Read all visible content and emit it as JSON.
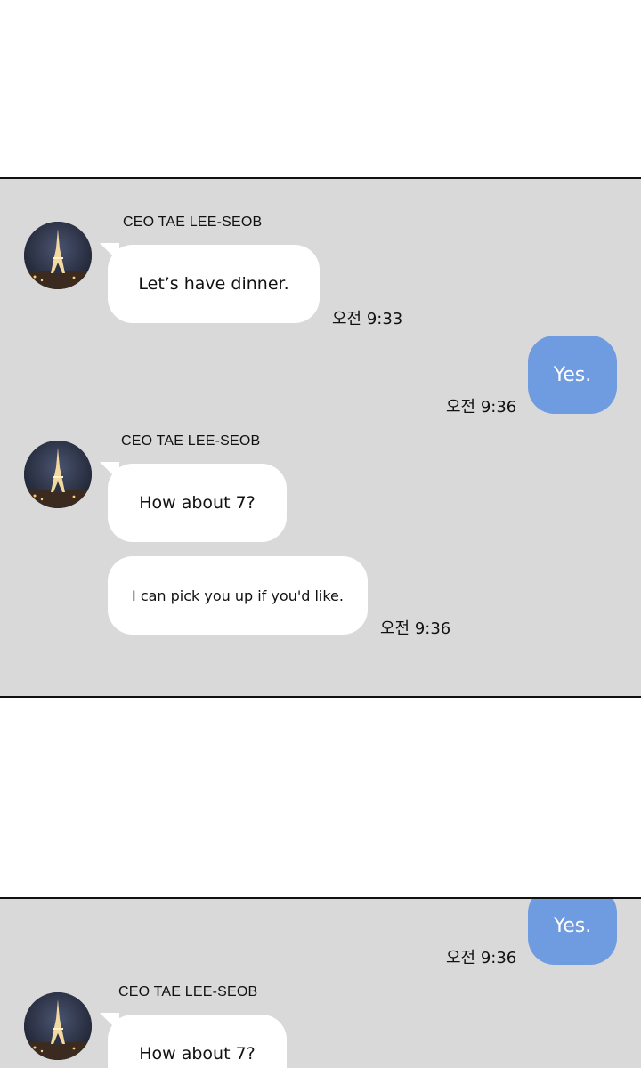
{
  "panels": [
    {
      "messages": [
        {
          "sender": "CEO TAE LEE-SEOB",
          "text": "Let’s have dinner.",
          "time": "오전 9:33"
        },
        {
          "text": "Yes.",
          "time": "오전 9:36"
        },
        {
          "sender": "CEO TAE LEE-SEOB",
          "text": "How about 7?"
        },
        {
          "text": "I can pick you up if you'd like.",
          "time": "오전 9:36"
        }
      ]
    },
    {
      "messages": [
        {
          "text": "Yes.",
          "time": "오전 9:36"
        },
        {
          "sender": "CEO TAE LEE-SEOB",
          "text": "How about 7?"
        }
      ]
    }
  ],
  "colors": {
    "panel_bg": "#d9d9d9",
    "received_bubble": "#ffffff",
    "sent_bubble": "#6f9be0",
    "border": "#111111"
  },
  "icons": {
    "avatar": "eiffel-tower-night-photo"
  }
}
